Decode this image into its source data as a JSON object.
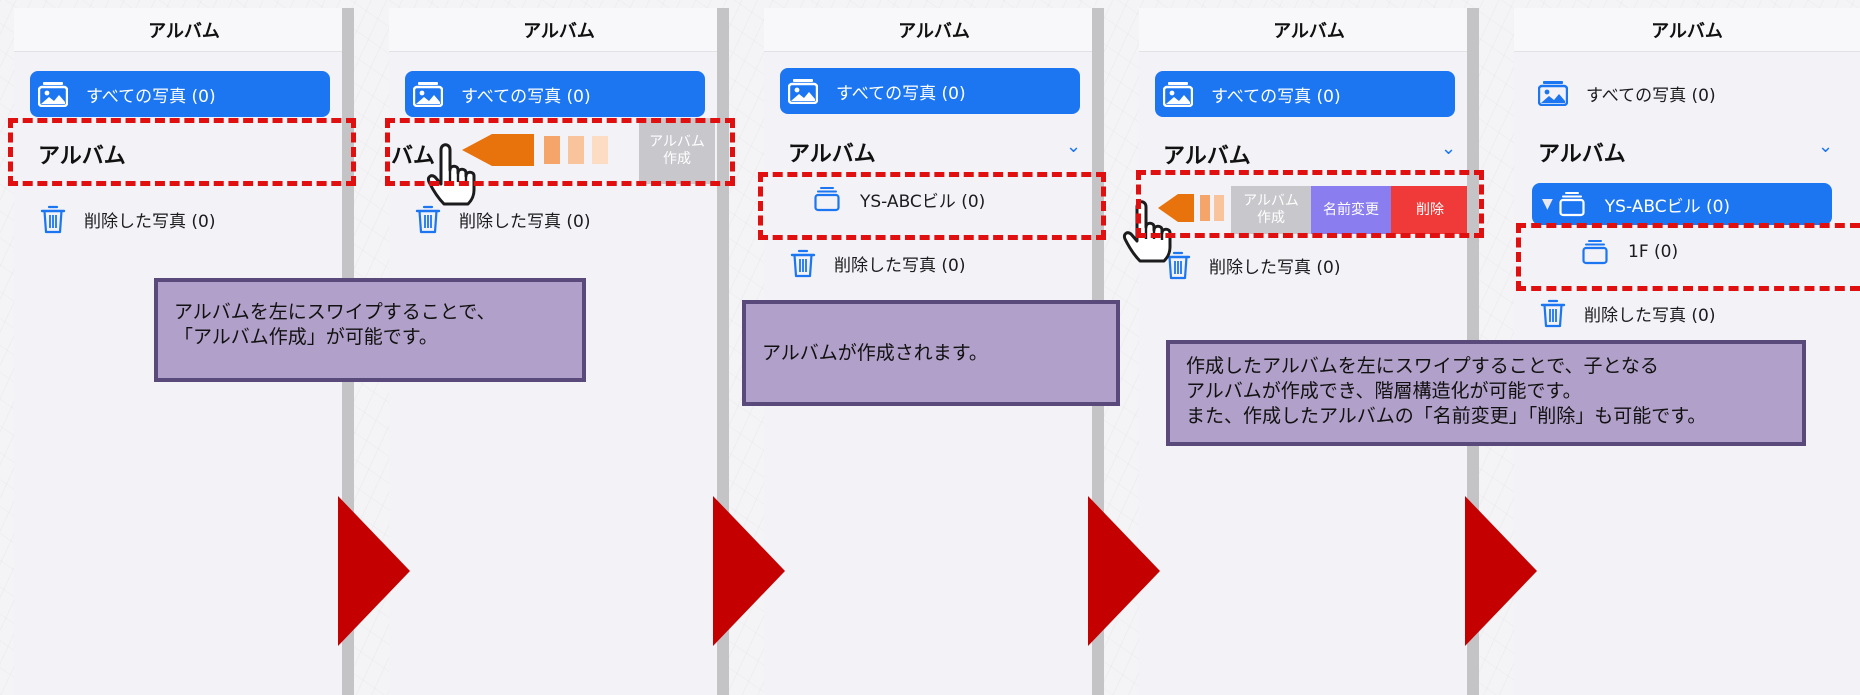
{
  "header_title": "アルバム",
  "all_photos_label": "すべての写真 (0)",
  "album_section_title": "アルバム",
  "album_section_title_clipped": "バム",
  "deleted_photos_label": "削除した写真 (0)",
  "album_item_label": "YS-ABCビル (0)",
  "child_album_label": "1F (0)",
  "swipe_actions": {
    "create_album": "アルバム\n作成",
    "rename": "名前変更",
    "delete": "削除"
  },
  "callouts": {
    "step1": "アルバムを左にスワイプすることで、\n「アルバム作成」が可能です。",
    "step2": "アルバムが作成されます。",
    "step3": "作成したアルバムを左にスワイプすることで、子となる\nアルバムが作成でき、階層構造化が可能です。\nまた、作成したアルバムの「名前変更」「削除」も可能です。"
  },
  "colors": {
    "accent_blue": "#1c76f2",
    "highlight_red": "#e01010",
    "step_arrow": "#c40000",
    "callout_fill": "#b1a0c9",
    "callout_border": "#5a4a7c",
    "swipe_orange": "#e8720c",
    "action_gray": "#c7c7cc",
    "action_purple": "#8a7df0",
    "action_red": "#f03a3a"
  },
  "icons": [
    "photo-icon",
    "trash-icon",
    "album-icon",
    "chevron-down-icon",
    "disclosure-triangle-icon",
    "pointing-hand-icon",
    "swipe-left-arrow-icon",
    "step-arrow-icon"
  ]
}
